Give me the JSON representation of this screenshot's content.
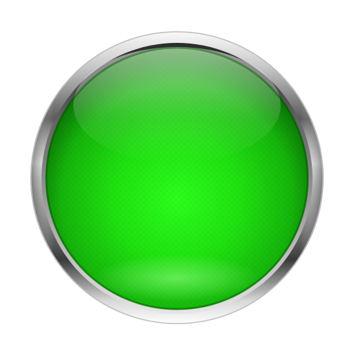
{
  "button": {
    "shape": "round-glossy-button",
    "state": "on",
    "colors": {
      "face_center": "#27ff16",
      "face_mid": "#1ad50d",
      "face_edge": "#0d7f08",
      "bezel_light": "#f4f4f4",
      "bezel_mid": "#b8b8b8",
      "bezel_dark": "#3d3d3d",
      "background": "#ffffff"
    }
  }
}
